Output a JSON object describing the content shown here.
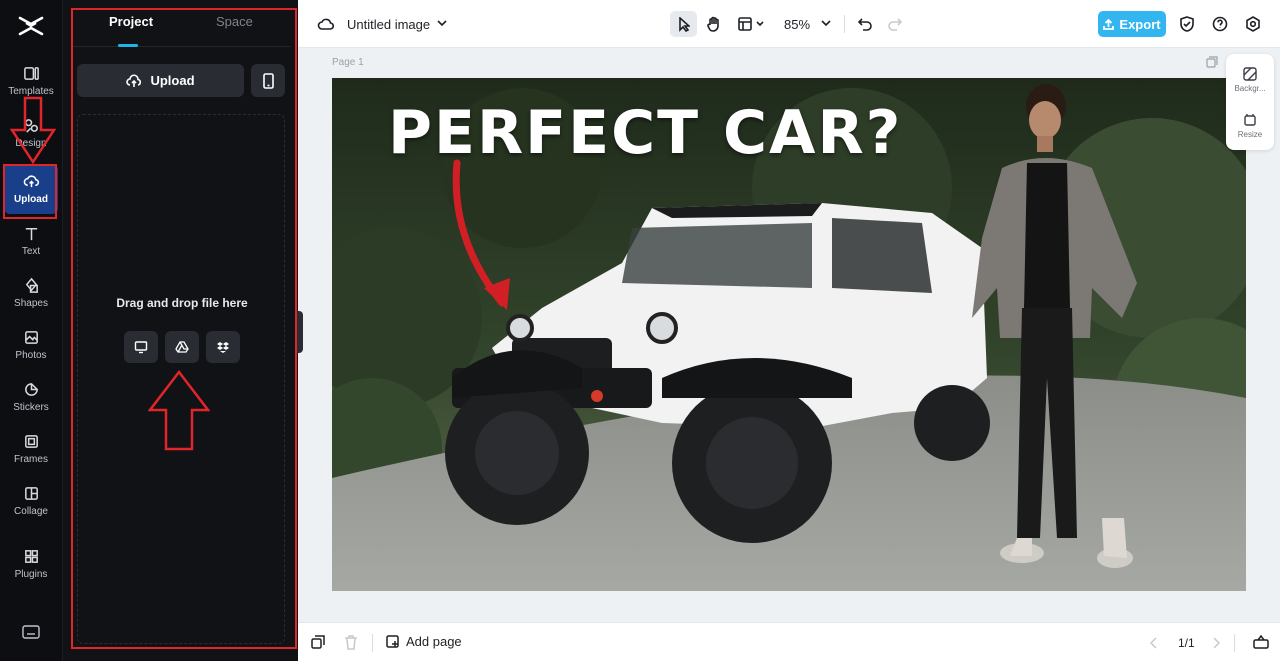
{
  "app": {
    "brand_icon": "capcut-logo-icon"
  },
  "rail": {
    "items": [
      {
        "label": "Templates",
        "icon": "templates-icon"
      },
      {
        "label": "Design",
        "icon": "design-icon"
      },
      {
        "label": "Upload",
        "icon": "cloud-upload-icon",
        "active": true
      },
      {
        "label": "Text",
        "icon": "text-icon"
      },
      {
        "label": "Shapes",
        "icon": "shapes-icon"
      },
      {
        "label": "Photos",
        "icon": "photos-icon"
      },
      {
        "label": "Stickers",
        "icon": "stickers-icon"
      },
      {
        "label": "Frames",
        "icon": "frames-icon"
      },
      {
        "label": "Collage",
        "icon": "collage-icon"
      },
      {
        "label": "Plugins",
        "icon": "plugins-icon"
      }
    ]
  },
  "panel": {
    "tabs": [
      {
        "label": "Project",
        "active": true
      },
      {
        "label": "Space"
      }
    ],
    "upload_label": "Upload",
    "drop_text": "Drag and drop file here"
  },
  "topbar": {
    "title": "Untitled image",
    "zoom": "85%",
    "export_label": "Export"
  },
  "canvas": {
    "page_label": "Page 1",
    "headline": "PERFECT CAR?"
  },
  "dock": {
    "background_label": "Backgr...",
    "resize_label": "Resize"
  },
  "bottombar": {
    "add_page_label": "Add page",
    "pager": "1/1"
  },
  "colors": {
    "accent": "#33b6f0",
    "annotation": "#e0252b",
    "rail_active": "#1a3f8a"
  }
}
